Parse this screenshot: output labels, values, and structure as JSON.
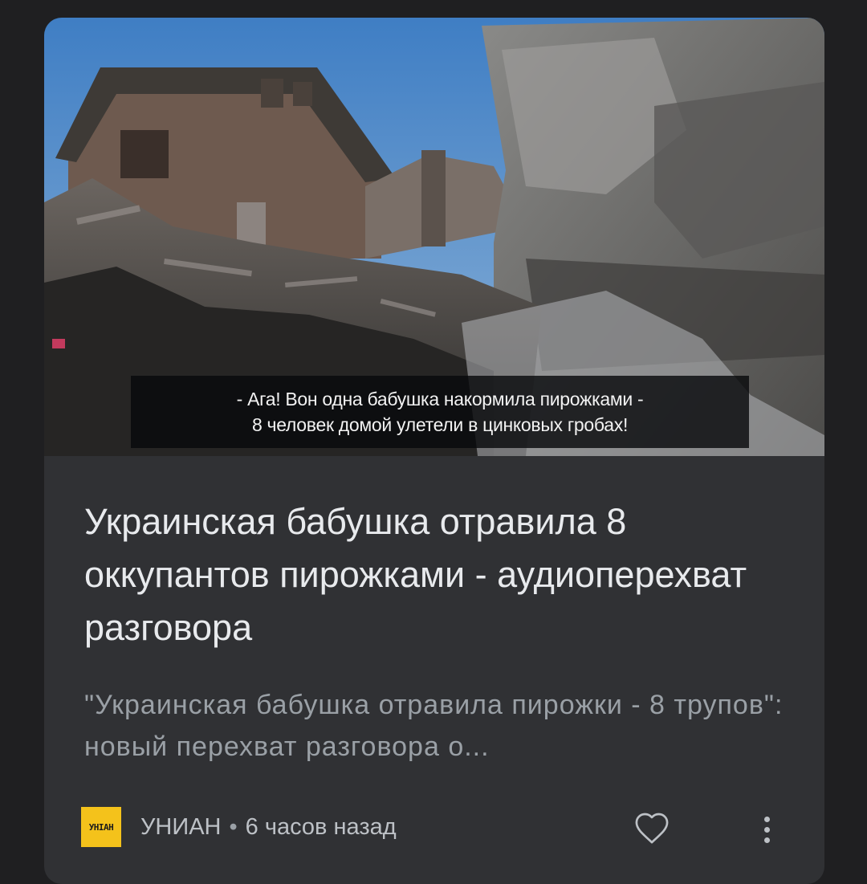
{
  "card": {
    "image": {
      "description_icon": "destroyed-buildings-photo",
      "subtitles": [
        "- Ага! Вон одна бабушка накормила пирожками -",
        "8 человек домой улетели в цинковых гробах!"
      ]
    },
    "headline": "Украинская бабушка отравила 8 оккупантов пирожками - аудиоперехват разговора",
    "snippet": "\"Украинская бабушка отравила пирожки - 8 трупов\": новый перехват разговора о...",
    "source": {
      "logo_text": "УНІАН",
      "name": "УНИАН",
      "separator": "•",
      "time": "6 часов назад"
    },
    "actions": {
      "like_icon": "heart-outline-icon",
      "more_icon": "more-vert-icon"
    }
  },
  "colors": {
    "page_background": "#1f1f21",
    "card_background": "#303134",
    "headline_text": "#e8eaed",
    "secondary_text": "#9aa0a6",
    "logo_background": "#f4c21b"
  }
}
